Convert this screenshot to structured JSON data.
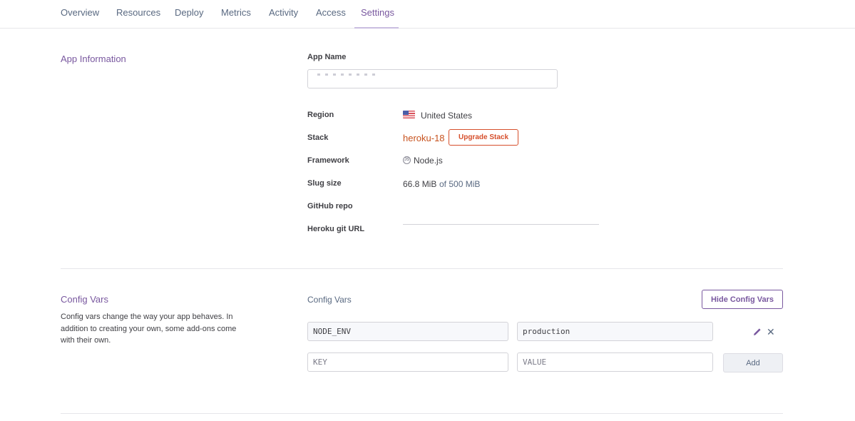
{
  "tabs": [
    {
      "label": "Overview"
    },
    {
      "label": "Resources"
    },
    {
      "label": "Deploy"
    },
    {
      "label": "Metrics"
    },
    {
      "label": "Activity"
    },
    {
      "label": "Access"
    },
    {
      "label": "Settings",
      "active": true
    }
  ],
  "app_info": {
    "section_title": "App Information",
    "app_name_label": "App Name",
    "app_name_value": "",
    "region_label": "Region",
    "region_value": "United States",
    "stack_label": "Stack",
    "stack_value": "heroku-18",
    "upgrade_button": "Upgrade Stack",
    "framework_label": "Framework",
    "framework_icon": "nodejs-icon",
    "framework_value": "Node.js",
    "slug_label": "Slug size",
    "slug_used": "66.8 MiB",
    "slug_limit": "of 500 MiB",
    "github_label": "GitHub repo",
    "git_url_label": "Heroku git URL"
  },
  "config_vars": {
    "section_title": "Config Vars",
    "description": "Config vars change the way your app behaves. In addition to creating your own, some add-ons come with their own.",
    "heading": "Config Vars",
    "hide_button": "Hide Config Vars",
    "vars": [
      {
        "key": "NODE_ENV",
        "value": "production"
      }
    ],
    "key_placeholder": "KEY",
    "value_placeholder": "VALUE",
    "add_button": "Add"
  },
  "colors": {
    "accent": "#79589f",
    "stack": "#c7521e",
    "upgrade": "#d64f2c",
    "muted": "#596981"
  }
}
